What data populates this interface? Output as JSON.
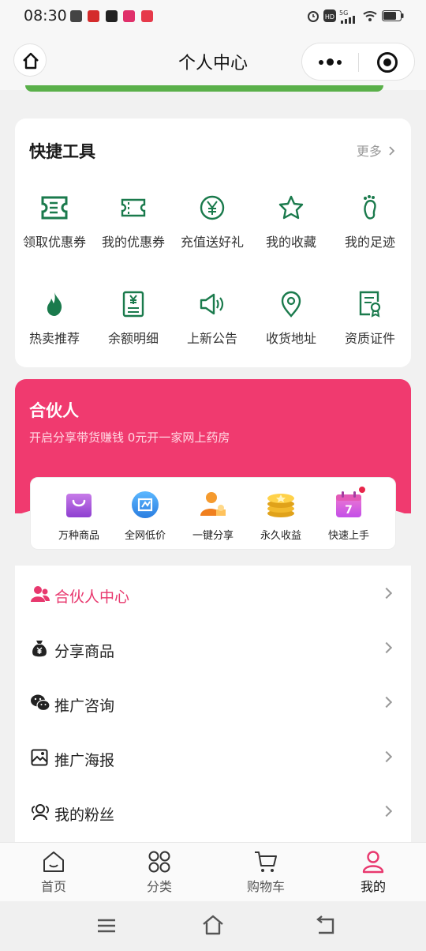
{
  "status_bar": {
    "time": "08:30",
    "network": "5G",
    "hd": "HD"
  },
  "header": {
    "title": "个人中心"
  },
  "quick_tools": {
    "title": "快捷工具",
    "more": "更多",
    "items": [
      {
        "label": "领取优惠券",
        "icon": "ticket-icon"
      },
      {
        "label": "我的优惠券",
        "icon": "coupon-icon"
      },
      {
        "label": "充值送好礼",
        "icon": "yen-circle-icon"
      },
      {
        "label": "我的收藏",
        "icon": "star-icon"
      },
      {
        "label": "我的足迹",
        "icon": "footprint-icon"
      },
      {
        "label": "热卖推荐",
        "icon": "flame-icon"
      },
      {
        "label": "余额明细",
        "icon": "balance-receipt-icon"
      },
      {
        "label": "上新公告",
        "icon": "speaker-icon"
      },
      {
        "label": "收货地址",
        "icon": "location-pin-icon"
      },
      {
        "label": "资质证件",
        "icon": "certificate-icon"
      }
    ],
    "icon_color": "#1a7a4c"
  },
  "partner": {
    "title": "合伙人",
    "subtitle": "开启分享带货赚钱 0元开一家网上药房",
    "color": "#f03a6f",
    "features": [
      {
        "label": "万种商品",
        "icon": "shopping-bag-icon"
      },
      {
        "label": "全网低价",
        "icon": "low-price-icon"
      },
      {
        "label": "一键分享",
        "icon": "share-person-icon"
      },
      {
        "label": "永久收益",
        "icon": "coin-stack-icon"
      },
      {
        "label": "快速上手",
        "icon": "calendar-icon",
        "day": "7"
      }
    ]
  },
  "menu": [
    {
      "label": "合伙人中心",
      "icon": "partner-person-icon",
      "highlight": true
    },
    {
      "label": "分享商品",
      "icon": "money-bag-icon"
    },
    {
      "label": "推广咨询",
      "icon": "wechat-icon"
    },
    {
      "label": "推广海报",
      "icon": "poster-icon"
    },
    {
      "label": "我的粉丝",
      "icon": "fans-icon"
    }
  ],
  "tabs": [
    {
      "label": "首页",
      "icon": "home-icon"
    },
    {
      "label": "分类",
      "icon": "category-icon"
    },
    {
      "label": "购物车",
      "icon": "cart-icon"
    },
    {
      "label": "我的",
      "icon": "profile-icon",
      "active": true
    }
  ],
  "accent_color": "#e8386e"
}
